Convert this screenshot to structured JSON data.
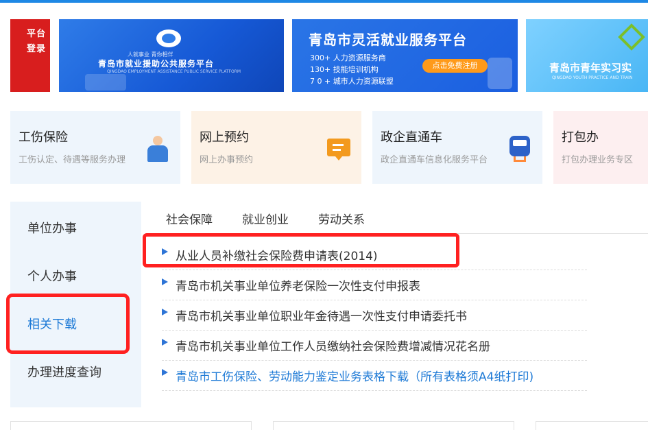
{
  "banners": [
    {
      "lines": [
        "平台",
        "登录"
      ]
    },
    {
      "caption": "人就事业 青你相伴",
      "title": "青岛市就业援助公共服务平台",
      "subtitle": "QINGDAO EMPLOYMENT ASSISTANCE PUBLIC SERVICE PLATFORM"
    },
    {
      "title": "青岛市灵活就业服务平台",
      "lines": [
        "300+ 人力资源服务商",
        "130+ 技能培训机构",
        "7 0 + 城市人力资源联盟"
      ],
      "cta": "点击免费注册"
    },
    {
      "title": "青岛市青年实习实",
      "subtitle": "QINGDAO YOUTH PRACTICE AND TRAIN"
    }
  ],
  "services": [
    {
      "title": "工伤保险",
      "desc": "工伤认定、待遇等服务办理",
      "icon": "injured-worker-icon"
    },
    {
      "title": "网上预约",
      "desc": "网上办事预约",
      "icon": "message-icon"
    },
    {
      "title": "政企直通车",
      "desc": "政企直通车信息化服务平台",
      "icon": "train-icon"
    },
    {
      "title": "打包办",
      "desc": "打包办理业务专区",
      "icon": ""
    }
  ],
  "leftnav": {
    "items": [
      "单位办事",
      "个人办事",
      "相关下载",
      "办理进度查询"
    ],
    "active": "相关下载"
  },
  "tabs": {
    "items": [
      "社会保障",
      "就业创业",
      "劳动关系"
    ],
    "active": "社会保障"
  },
  "downloads": [
    "从业人员补缴社会保险费申请表(2014)",
    "青岛市机关事业单位养老保险一次性支付申报表",
    "青岛市机关事业单位职业年金待遇一次性支付申请委托书",
    "青岛市机关事业单位工作人员缴纳社会保险费增减情况花名册",
    "青岛市工伤保险、劳动能力鉴定业务表格下载（所有表格须A4纸打印)"
  ],
  "colors": {
    "accent": "#1e7ad6",
    "highlight": "#ff2020"
  }
}
